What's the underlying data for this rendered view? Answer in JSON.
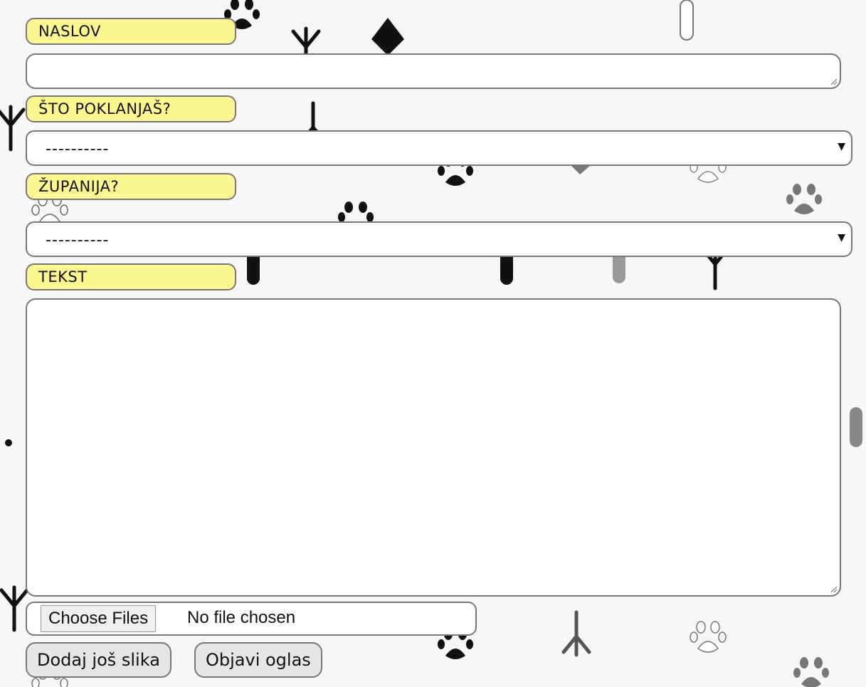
{
  "form": {
    "naslov": {
      "label": "NASLOV",
      "value": ""
    },
    "sto_poklanjas": {
      "label": "ŠTO POKLANJAŠ?",
      "selected": "----------"
    },
    "zupanija": {
      "label": "ŽUPANIJA?",
      "selected": "----------"
    },
    "tekst": {
      "label": "TEKST",
      "value": ""
    },
    "file_input": {
      "button_label": "Choose Files",
      "status": "No file chosen"
    },
    "actions": {
      "add_more_images": "Dodaj još slika",
      "publish": "Objavi oglas"
    }
  },
  "colors": {
    "label_background": "#fdf791",
    "border": "#777777",
    "page_background": "#f7f7f7",
    "button_background": "#e6e6e6"
  },
  "icons": [
    "paw-print-icon",
    "bird-track-icon",
    "dropdown-arrow-icon",
    "resize-handle-icon"
  ]
}
